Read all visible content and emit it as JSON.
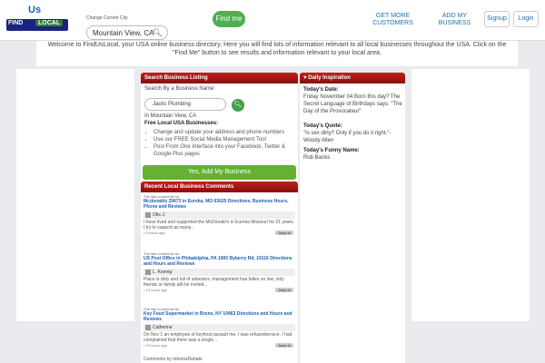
{
  "logo": {
    "us": "Us",
    "find": "FIND",
    "local": "LOCAL"
  },
  "header": {
    "city_label": "Change Current City",
    "city_value": "Mountain View, CA",
    "find_me": "Find me",
    "get_more": "GET MORE CUSTOMERS",
    "add_business": "ADD MY BUSINESS",
    "signup": "Signup",
    "login": "Login"
  },
  "welcome": "Welcome to FindUsLocal, your USA online business directory. Here you will find lots of information relevant to all local businesses throughout the USA. Click on the \"Find Me\" button to see results and information relevant to your local area.",
  "search": {
    "title": "Search Business Listing",
    "label": "Search By a Business Name:",
    "value": "Jacks Plumbing",
    "location": "In Mountain View, CA",
    "free_title": "Free Local USA Businesses:",
    "items": [
      "Change and update your address and phone numbers",
      "Use our FREE Social Media Management Tool",
      "Post From One Interface into your Facebook, Twitter & Google Plus pages"
    ],
    "add_btn": "Yes, Add My Business"
  },
  "inspiration": {
    "title": "Daily Inspiration",
    "date_label": "Today's Date:",
    "date_text": "Friday November 04 Born this day? The Secret Language of Birthdays says: \"The Day of the Provocateur\"",
    "quote_label": "Today's Quote:",
    "quote_text": "\"Is sex dirty? Only if you do it right.\"- Woody Allen",
    "funny_label": "Today's Funny Name:",
    "funny_text": "Rob Banks"
  },
  "comments": {
    "title": "Recent Local Business Comments",
    "jump": "Jump to",
    "items": [
      {
        "pre": "The last comments for",
        "title": "Mcdonalds 29673 in Eureka, MO 63025 Directions, Business Hours, Phone and Reviews",
        "user": "Otis J.",
        "text": "I have lived and supported the McDonald's in Eureka Missouri for 21 years. I try to support as many...",
        "time": "• 9 hours ago"
      },
      {
        "pre": "The last comments for",
        "title": "US Post Office in Philadelphia, PA 1900 Byberry Rd, 19116 Directions and Hours and Reviews",
        "user": "L. Koenig",
        "text": "Place is dirty and full of asbestos, management has fallen so low, only friends or family will be invited...",
        "time": "• 13 hours ago"
      },
      {
        "pre": "The last comments for",
        "title": "Key Food Supermarket in Bronx, NY 10463 Directions and Hours and Reviews",
        "user": "Catherine",
        "text": "On Nov 1 an employee of keyfood assault me. I was refusedservice. I had complained that there was a single...",
        "time": "• 23 hours ago"
      }
    ],
    "by": "Comments by IntenseDebate"
  }
}
